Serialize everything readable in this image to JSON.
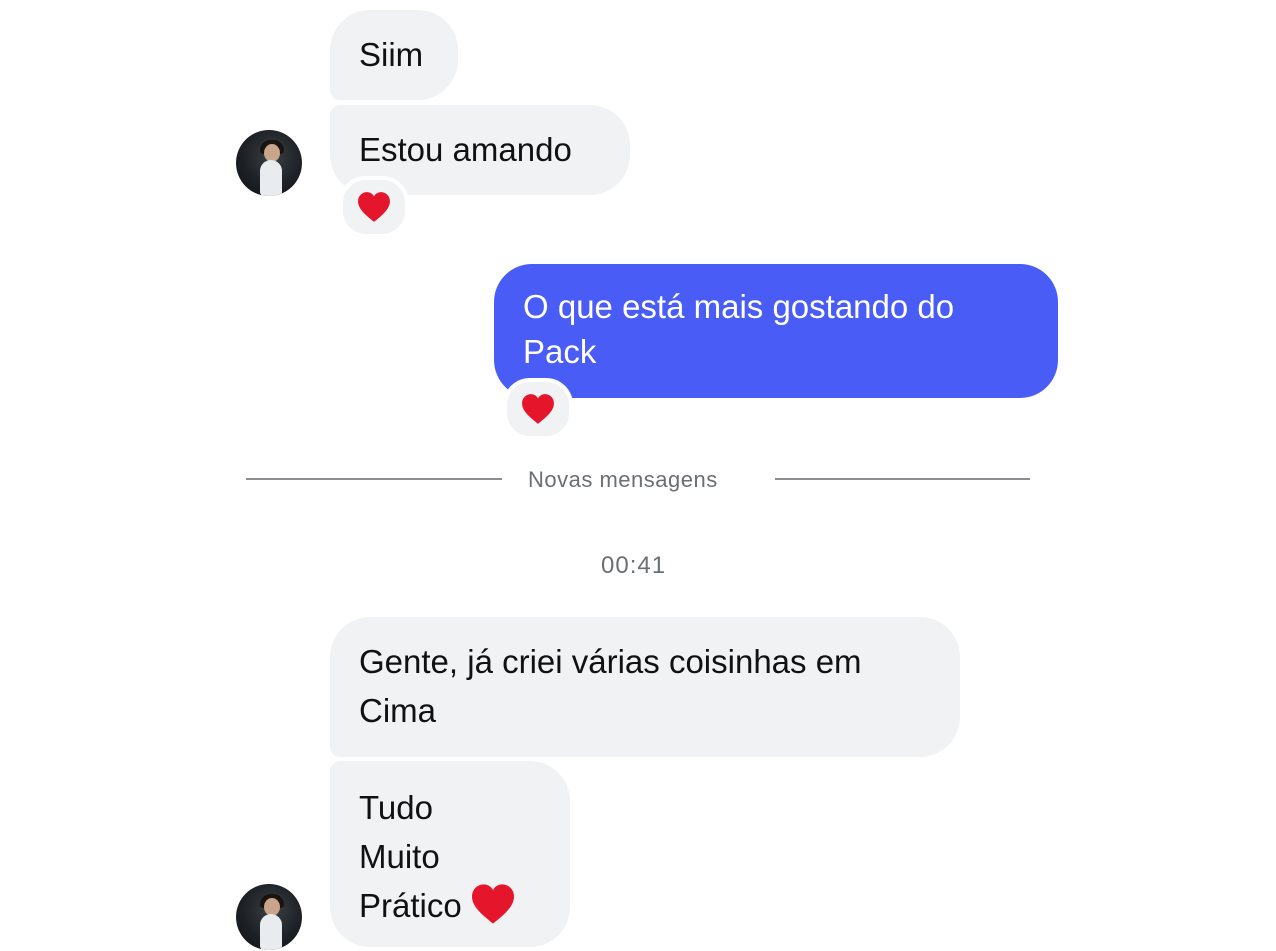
{
  "messages": {
    "m1": "Siim",
    "m2": "Estou amando",
    "m3_line1": "O que está mais gostando do",
    "m3_line2": "Pack",
    "m4_line1": "Gente, já criei várias coisinhas em",
    "m4_line2": "Cima",
    "m5_line1": "Tudo",
    "m5_line2": "Muito",
    "m5_line3": "Prático"
  },
  "divider": {
    "label": "Novas mensagens"
  },
  "timestamp": "00:41",
  "reactions": [
    "heart-icon",
    "heart-icon"
  ],
  "colors": {
    "outgoing_bubble": "#4a5cf6",
    "incoming_bubble": "#f1f2f4",
    "heart": "#e5162b"
  }
}
